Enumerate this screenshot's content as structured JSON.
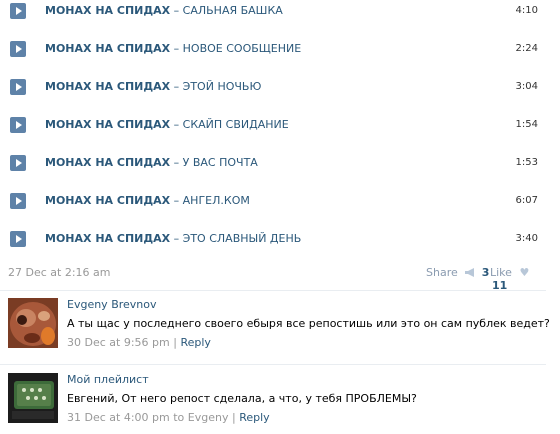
{
  "tracks": [
    {
      "artist": "МОНАХ НА СПИДАХ",
      "title": "САЛЬНАЯ БАШКА",
      "duration": "4:10"
    },
    {
      "artist": "МОНАХ НА СПИДАХ",
      "title": "НОВОЕ СООБЩЕНИЕ",
      "duration": "2:24"
    },
    {
      "artist": "МОНАХ НА СПИДАХ",
      "title": "ЭТОЙ НОЧЬЮ",
      "duration": "3:04"
    },
    {
      "artist": "МОНАХ НА СПИДАХ",
      "title": "СКАЙП СВИДАНИЕ",
      "duration": "1:54"
    },
    {
      "artist": "МОНАХ НА СПИДАХ",
      "title": "У ВАС ПОЧТА",
      "duration": "1:53"
    },
    {
      "artist": "МОНАХ НА СПИДАХ",
      "title": "АНГЕЛ.КОМ",
      "duration": "6:07"
    },
    {
      "artist": "МОНАХ НА СПИДАХ",
      "title": "ЭТО СЛАВНЫЙ ДЕНЬ",
      "duration": "3:40"
    }
  ],
  "dash": "–",
  "post": {
    "date": "27 Dec at 2:16 am",
    "share_label": "Share",
    "share_count": "3",
    "like_label": "Like",
    "like_count": "11"
  },
  "comments": [
    {
      "author": "Evgeny Brevnov",
      "text": "А ты щас у последнего своего ебыря все репостишь или это он сам публек ведет?",
      "date": "30 Dec at 9:56 pm",
      "separator": "|",
      "reply_label": "Reply"
    },
    {
      "author": "Мой плейлист",
      "text": "Евгений, От него репост сделала, а что, у тебя ПРОБЛЕМЫ?",
      "date": "31 Dec at 4:00 pm",
      "to_text": "to Evgeny",
      "separator": "|",
      "reply_label": "Reply"
    }
  ],
  "colors": {
    "link": "#2b587a",
    "play_button": "#5e82a8",
    "muted": "#999999",
    "separator": "#e9edf1"
  },
  "icons": {
    "play": "play-icon",
    "share": "megaphone-icon",
    "like": "heart-icon"
  }
}
